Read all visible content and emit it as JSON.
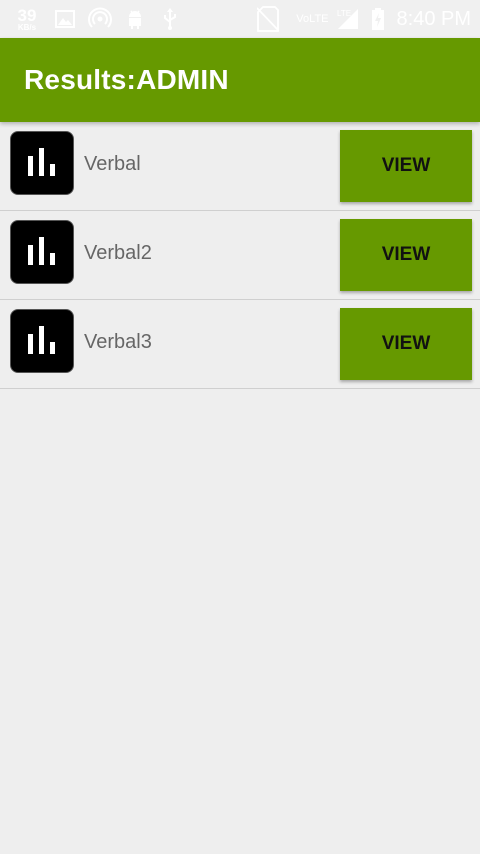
{
  "status_bar": {
    "net_speed_value": "39",
    "net_speed_unit": "KB/s",
    "network_type": "VoLTE",
    "signal_type": "LTE",
    "time": "8:40 PM"
  },
  "app_bar": {
    "title": "Results:ADMIN",
    "color": "#669900"
  },
  "results": [
    {
      "label": "Verbal",
      "button_label": "VIEW",
      "icon": "bar-chart-icon"
    },
    {
      "label": "Verbal2",
      "button_label": "VIEW",
      "icon": "bar-chart-icon"
    },
    {
      "label": "Verbal3",
      "button_label": "VIEW",
      "icon": "bar-chart-icon"
    }
  ]
}
